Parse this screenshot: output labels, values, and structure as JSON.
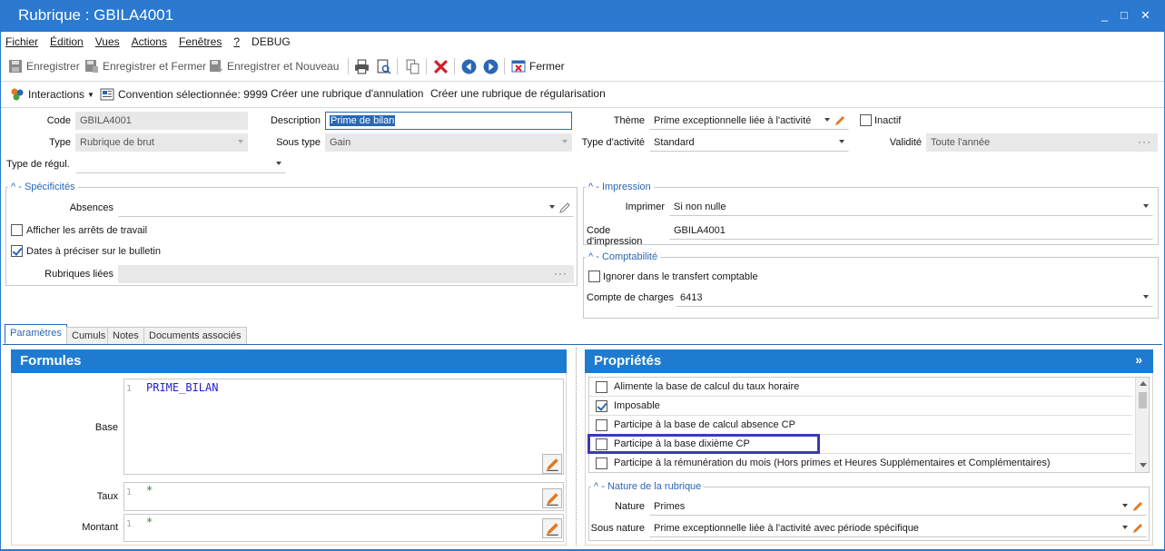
{
  "window": {
    "title": "Rubrique : GBILA4001",
    "controls": [
      "_",
      "□",
      "✕"
    ]
  },
  "menu": [
    "Fichier",
    "Édition",
    "Vues",
    "Actions",
    "Fenêtres",
    "?",
    "DEBUG"
  ],
  "toolbar": {
    "save": "Enregistrer",
    "save_close": "Enregistrer et Fermer",
    "save_new": "Enregistrer et Nouveau",
    "close": "Fermer"
  },
  "actionbar": {
    "interactions": "Interactions",
    "convention": "Convention sélectionnée: 9999",
    "create_cancel": "Créer une rubrique d'annulation",
    "create_regul": "Créer une rubrique de régularisation"
  },
  "form": {
    "code_label": "Code",
    "code_value": "GBILA4001",
    "description_label": "Description",
    "description_value": "Prime de bilan",
    "theme_label": "Thème",
    "theme_value": "Prime exceptionnelle liée à l'activité",
    "inactive_label": "Inactif",
    "type_label": "Type",
    "type_value": "Rubrique de brut",
    "subtype_label": "Sous type",
    "subtype_value": "Gain",
    "activity_label": "Type d'activité",
    "activity_value": "Standard",
    "validity_label": "Validité",
    "validity_value": "Toute l'année",
    "regul_label": "Type de régul.",
    "regul_value": ""
  },
  "specificites": {
    "title": "Spécificités",
    "absences_label": "Absences",
    "absences_value": "",
    "show_stops": "Afficher les arrêts de travail",
    "dates_bulletin": "Dates à préciser sur le bulletin",
    "linked_label": "Rubriques liées",
    "linked_value": ""
  },
  "impression": {
    "title": "Impression",
    "print_label": "Imprimer",
    "print_value": "Si non nulle",
    "code_label": "Code d'impression",
    "code_value": "GBILA4001"
  },
  "comptabilite": {
    "title": "Comptabilité",
    "ignore_label": "Ignorer dans le transfert comptable",
    "account_label": "Compte de charges",
    "account_value": "6413"
  },
  "tabs": [
    "Paramètres",
    "Cumuls",
    "Notes",
    "Documents associés"
  ],
  "formules": {
    "title": "Formules",
    "base_label": "Base",
    "base_line": "1",
    "base_code": "PRIME_BILAN",
    "taux_label": "Taux",
    "taux_line": "1",
    "taux_code": "*",
    "montant_label": "Montant",
    "montant_line": "1",
    "montant_code": "*"
  },
  "proprietes": {
    "title": "Propriétés",
    "expand": "»",
    "items": [
      {
        "label": "Alimente la base de calcul du taux horaire",
        "checked": false
      },
      {
        "label": "Imposable",
        "checked": true
      },
      {
        "label": "Participe à la base de calcul absence CP",
        "checked": false
      },
      {
        "label": "Participe à la base dixième CP",
        "checked": false
      },
      {
        "label": "Participe à la rémunération du mois (Hors primes et Heures Supplémentaires et Complémentaires)",
        "checked": false
      }
    ]
  },
  "nature": {
    "title": "Nature de la rubrique",
    "nature_label": "Nature",
    "nature_value": "Primes",
    "subnature_label": "Sous nature",
    "subnature_value": "Prime exceptionnelle liée à l'activité avec période spécifique"
  },
  "colors": {
    "titlebar": "#2b79d0",
    "panel_header": "#1e7bd0",
    "accent": "#2a67b4",
    "highlight_box": "#3a3ab8",
    "delete": "#d0202a"
  },
  "state": {
    "dates_bulletin_checked": true,
    "show_stops_checked": false,
    "ignore_checked": false,
    "inactive_checked": false
  }
}
